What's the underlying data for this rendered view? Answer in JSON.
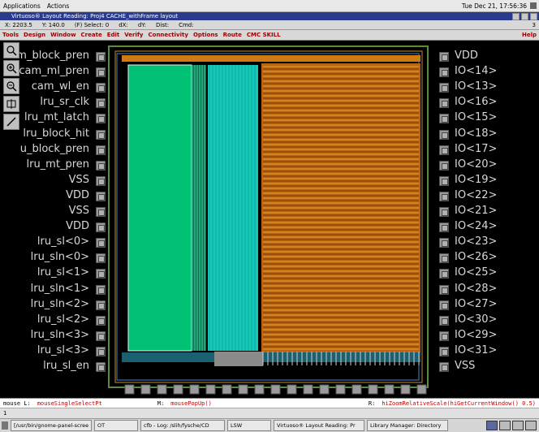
{
  "topbar": {
    "applications": "Applications",
    "actions": "Actions",
    "clock": "Tue Dec 21, 17:56:36"
  },
  "window": {
    "title": "Virtuoso® Layout Reading: Proj4 CACHE_withFrame layout",
    "corner": "3"
  },
  "status": {
    "x": "X: 2203.5",
    "y": "Y: 140.0",
    "select": "(F) Select: 0",
    "dx": "dX:",
    "dy": "dY:",
    "dist": "Dist:",
    "cmd": "Cmd:"
  },
  "menu": [
    "Tools",
    "Design",
    "Window",
    "Create",
    "Edit",
    "Verify",
    "Connectivity",
    "Options",
    "Route",
    "CMC SKILL"
  ],
  "menu_help": "Help",
  "left_pins": [
    "m_block_pren",
    "cam_ml_pren",
    "cam_wl_en",
    "lru_sr_clk",
    "lru_mt_latch",
    "lru_block_hit",
    "u_block_pren",
    "lru_mt_pren",
    "VSS",
    "VDD",
    "VSS",
    "VDD",
    "lru_sl<0>",
    "lru_sln<0>",
    "lru_sl<1>",
    "lru_sln<1>",
    "lru_sln<2>",
    "lru_sl<2>",
    "lru_sln<3>",
    "lru_sl<3>",
    "lru_sl_en"
  ],
  "right_pins": [
    "VDD",
    "IO<14>",
    "IO<13>",
    "IO<16>",
    "IO<15>",
    "IO<18>",
    "IO<17>",
    "IO<20>",
    "IO<19>",
    "IO<22>",
    "IO<21>",
    "IO<24>",
    "IO<23>",
    "IO<26>",
    "IO<25>",
    "IO<28>",
    "IO<27>",
    "IO<30>",
    "IO<29>",
    "IO<31>",
    "VSS"
  ],
  "messages": {
    "left_key": "mouse L:",
    "left_val": "mouseSingleSelectPt",
    "mid_key": "M:",
    "mid_val": "mousePopUp()",
    "right_key": "R:",
    "right_val": "hiZoomRelativeScale(hiGetCurrentWindow() 0.5)"
  },
  "prompt": "1",
  "taskbar": [
    {
      "label": "[/usr/bin/gnome-panel-scree"
    },
    {
      "label": "OT"
    },
    {
      "label": "cfb - Log: /slih/fysche/CD"
    },
    {
      "label": "LSW"
    },
    {
      "label": "Virtuoso® Layout Reading: Pr"
    },
    {
      "label": "Library Manager: Directory"
    }
  ],
  "colors": {
    "titlebar": "#2a3a8c",
    "green": "#00cc77",
    "cyan": "#19d3c5",
    "orange": "#e08a1e",
    "frame": "#5a8c3a"
  }
}
